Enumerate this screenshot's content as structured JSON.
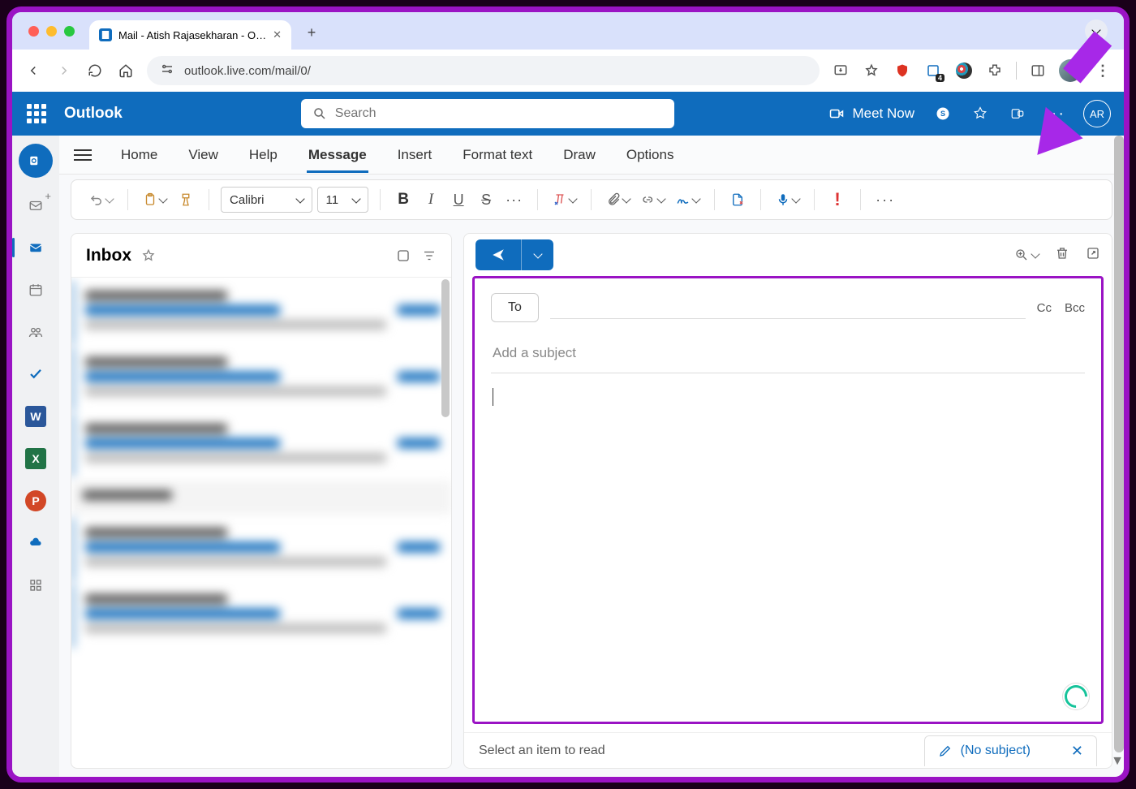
{
  "browser": {
    "tab_title": "Mail - Atish Rajasekharan - O…",
    "url": "outlook.live.com/mail/0/",
    "traffic_colors": [
      "#ff5f57",
      "#febc2e",
      "#28c840"
    ]
  },
  "outlook_header": {
    "brand": "Outlook",
    "search_placeholder": "Search",
    "meet_now": "Meet Now",
    "avatar_initials": "AR"
  },
  "ribbon": {
    "tabs": [
      "Home",
      "View",
      "Help",
      "Message",
      "Insert",
      "Format text",
      "Draw",
      "Options"
    ],
    "selected_index": 3,
    "font_name": "Calibri",
    "font_size": "11"
  },
  "left_rail": {
    "items": [
      "outlook",
      "mail",
      "new-mail",
      "calendar",
      "people",
      "todo",
      "word",
      "excel",
      "powerpoint",
      "onedrive",
      "more-apps"
    ]
  },
  "inbox": {
    "title": "Inbox"
  },
  "compose": {
    "to_label": "To",
    "cc_label": "Cc",
    "bcc_label": "Bcc",
    "subject_placeholder": "Add a subject"
  },
  "bottom": {
    "prompt": "Select an item to read",
    "tab_label": "(No subject)"
  },
  "colors": {
    "accent": "#0f6cbd",
    "highlight": "#9a13c4"
  }
}
